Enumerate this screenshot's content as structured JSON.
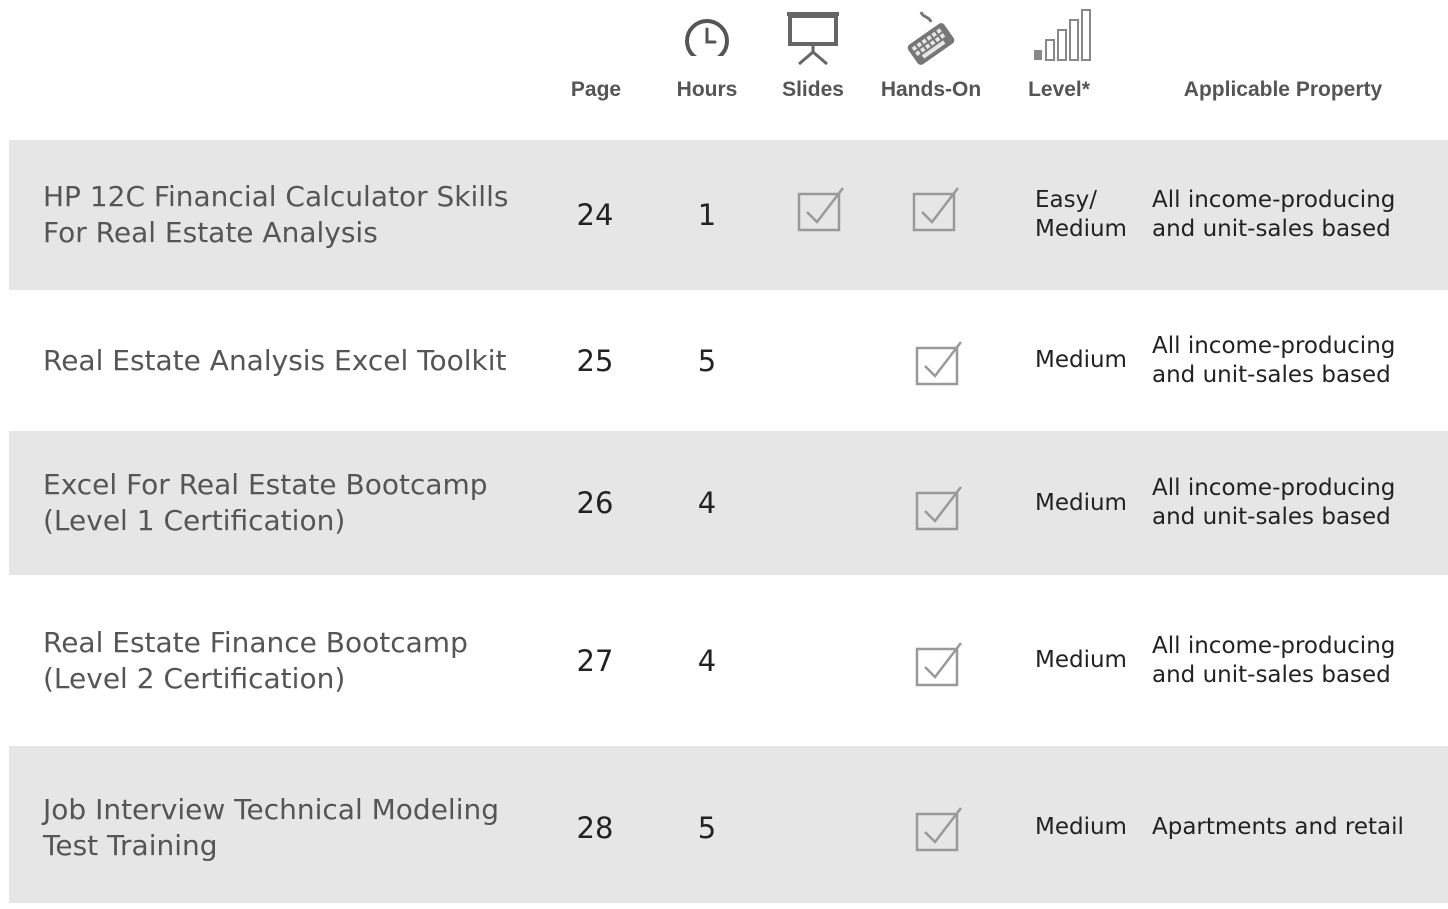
{
  "header": {
    "page_label": "Page",
    "hours_label": "Hours",
    "slides_label": "Slides",
    "hands_on_label": "Hands-On",
    "level_label": "Level*",
    "property_label": "Applicable Property",
    "icons": [
      "clock-icon",
      "presentation-screen-icon",
      "keyboard-icon",
      "signal-bars-icon"
    ]
  },
  "rows": [
    {
      "title": "HP 12C Financial Calculator Skills For Real Estate Analysis",
      "page": "24",
      "hours": "1",
      "slides": true,
      "hands_on": true,
      "level": "Easy/ Medium",
      "property": "All income-producing and unit-sales based"
    },
    {
      "title": "Real Estate Analysis Excel Toolkit",
      "page": "25",
      "hours": "5",
      "slides": false,
      "hands_on": true,
      "level": "Medium",
      "property": "All income-producing and unit-sales based"
    },
    {
      "title": "Excel For Real Estate Bootcamp (Level 1 Certification)",
      "page": "26",
      "hours": "4",
      "slides": false,
      "hands_on": true,
      "level": "Medium",
      "property": "All income-producing and unit-sales based"
    },
    {
      "title": "Real Estate Finance Bootcamp (Level 2 Certification)",
      "page": "27",
      "hours": "4",
      "slides": false,
      "hands_on": true,
      "level": "Medium",
      "property": "All income-producing and unit-sales based"
    },
    {
      "title": "Job Interview Technical Modeling Test Training",
      "page": "28",
      "hours": "5",
      "slides": false,
      "hands_on": true,
      "level": "Medium",
      "property": "Apartments and retail"
    }
  ],
  "colors": {
    "row_shade": "#e6e6e6",
    "icon_gray": "#888888",
    "label_gray": "#555555"
  }
}
